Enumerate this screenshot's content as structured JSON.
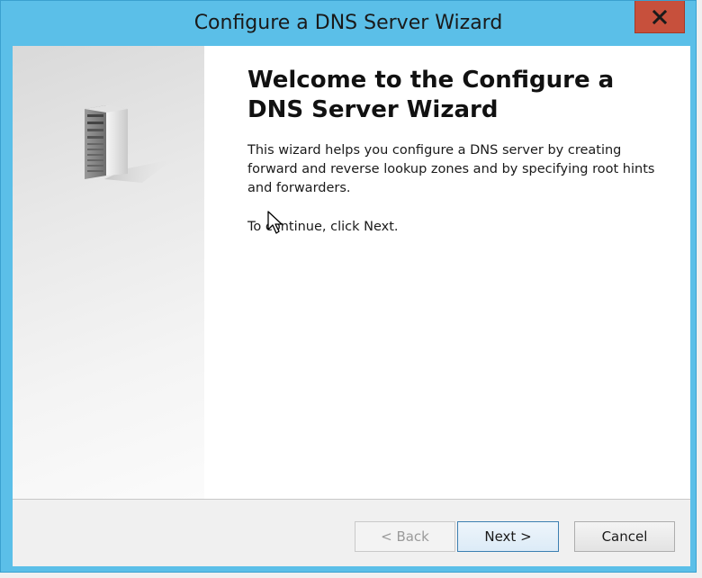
{
  "window": {
    "title": "Configure a DNS Server Wizard",
    "close_label": "X",
    "accent_color": "#5bbfe8",
    "close_color": "#c7503c"
  },
  "side_panel": {
    "icon": "server-icon"
  },
  "content": {
    "heading": "Welcome to the Configure a DNS Server Wizard",
    "intro": "This wizard helps you configure a DNS server by creating forward and reverse lookup zones and by specifying root hints and forwarders.",
    "continue_text": "To continue, click Next."
  },
  "buttons": {
    "back_label": "< Back",
    "back_enabled": false,
    "next_label": "Next >",
    "cancel_label": "Cancel"
  }
}
